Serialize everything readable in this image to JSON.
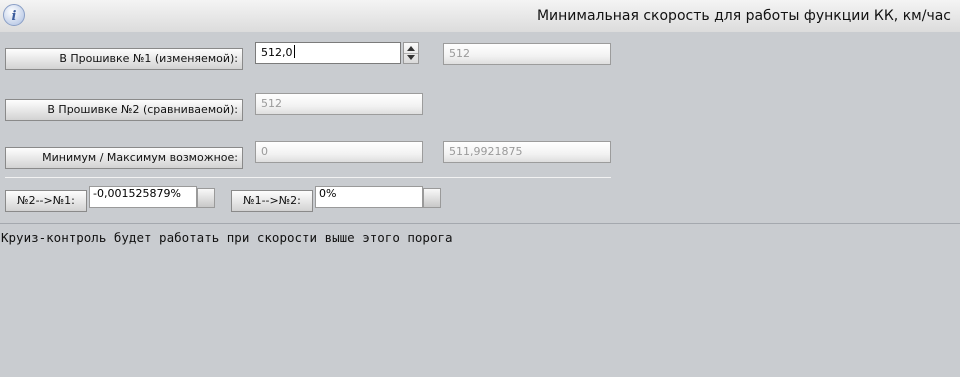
{
  "title": "Минимальная скорость для работы функции КК, км/час",
  "info_icon": "info-icon",
  "rows": {
    "fw1": {
      "label": "В Прошивке №1 (изменяемой):",
      "value": "512,0",
      "raw": "512"
    },
    "fw2": {
      "label": "В Прошивке №2 (сравниваемой):",
      "value": "512"
    },
    "limits": {
      "label": "Минимум / Максимум возможное:",
      "min": "0",
      "max": "511,9921875"
    }
  },
  "diff": {
    "n2_to_n1_label": "№2-->№1:",
    "n2_to_n1_value": "-0,001525879%",
    "n1_to_n2_label": "№1-->№2:",
    "n1_to_n2_value": "0%"
  },
  "description": "Круиз-контроль будет работать при скорости выше этого порога"
}
